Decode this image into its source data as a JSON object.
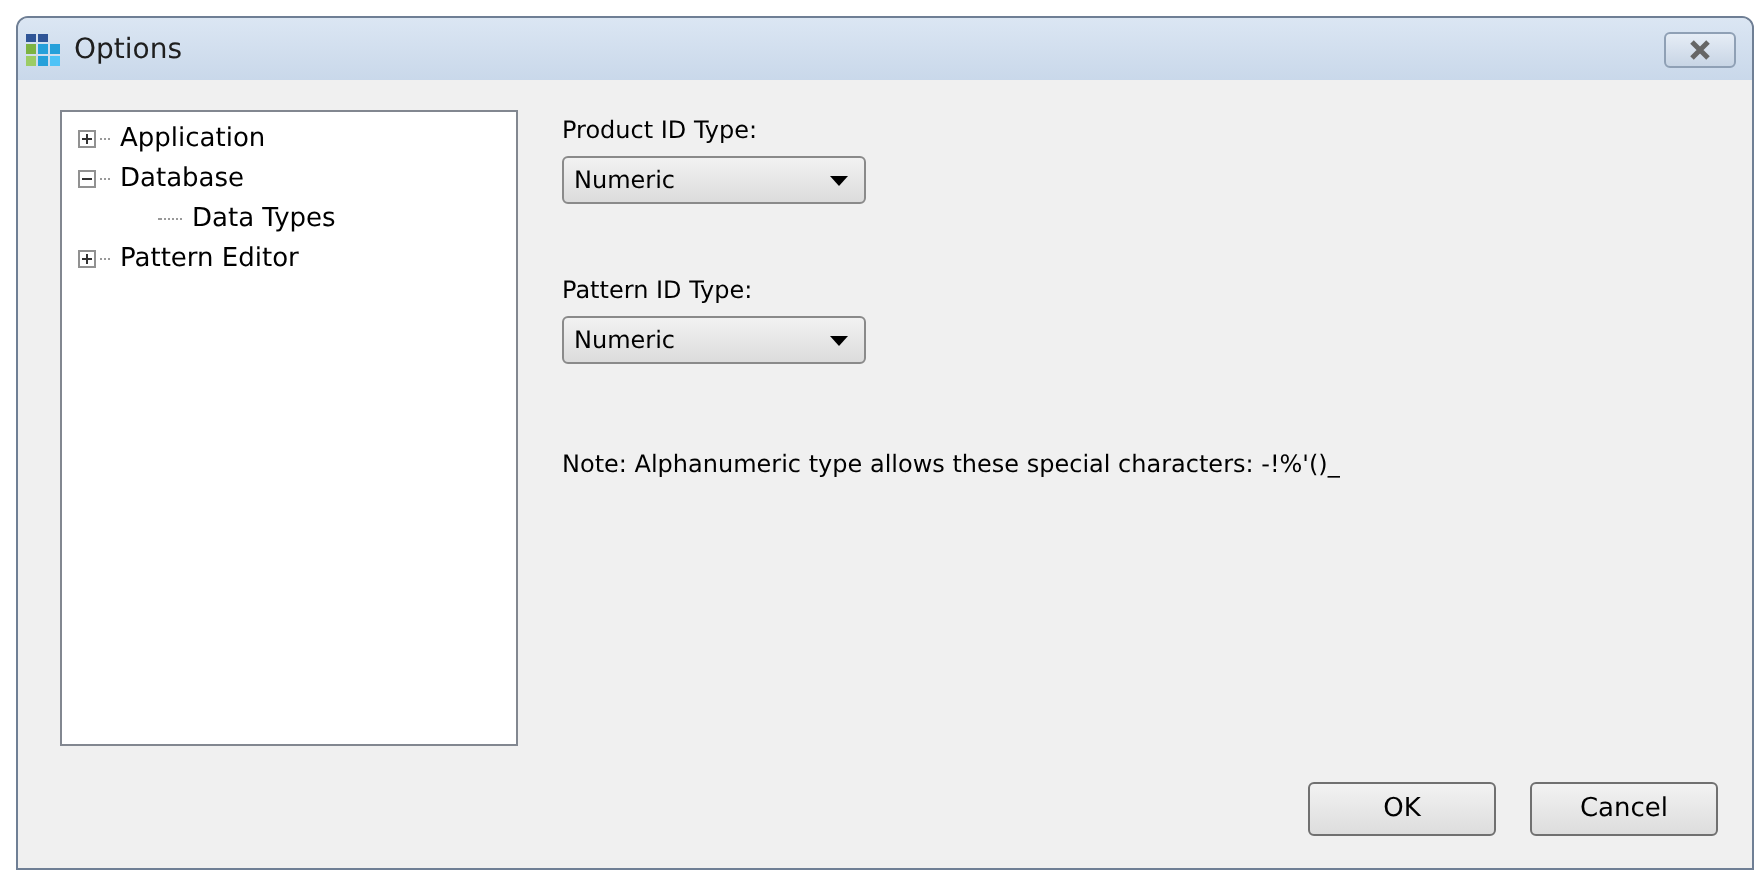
{
  "window": {
    "title": "Options"
  },
  "tree": [
    {
      "label": "Application",
      "expanded": false
    },
    {
      "label": "Database",
      "expanded": true,
      "children": [
        {
          "label": "Data Types"
        }
      ]
    },
    {
      "label": "Pattern Editor",
      "expanded": false
    }
  ],
  "fields": [
    {
      "label": "Product ID Type:",
      "value": "Numeric"
    },
    {
      "label": "Pattern ID Type:",
      "value": "Numeric"
    }
  ],
  "note": "Note: Alphanumeric type allows these special characters: -!%'()_",
  "buttons": [
    "OK",
    "Cancel"
  ]
}
